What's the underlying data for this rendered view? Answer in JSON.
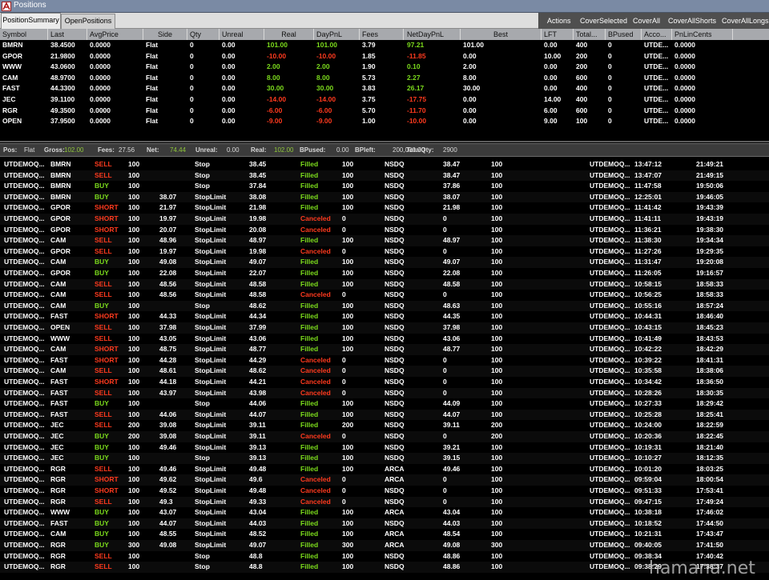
{
  "window": {
    "title": "Positions",
    "icon": "app-logo-icon"
  },
  "tabs": [
    {
      "label": "PositionSummary",
      "active": true
    },
    {
      "label": "OpenPositions",
      "active": false
    }
  ],
  "actions": [
    "Actions",
    "CoverSelected",
    "CoverAll",
    "CoverAllShorts",
    "CoverAllLongs"
  ],
  "colors": {
    "positive": "#7cdc1c",
    "negative": "#ff3a1e",
    "filled": "#7cdc1c",
    "canceled": "#ff3a1e",
    "buy": "#7cdc1c",
    "sell": "#ff3a1e",
    "header_bg": "#a7a9ad",
    "status_green": "#8fc63a"
  },
  "positions": {
    "columns": [
      "Symbol",
      "Last",
      "AvgPrice",
      "Side",
      "Qty",
      "Unreal",
      "Real",
      "DayPnL",
      "Fees",
      "NetDayPnL",
      "Best",
      "LFT",
      "Total...",
      "BPused",
      "Acco...",
      "PnLinCents"
    ],
    "rows": [
      {
        "cells": [
          "BMRN",
          "38.4500",
          "0.0000",
          "Flat",
          "0",
          "0.00",
          "101.00",
          "101.00",
          "3.79",
          "97.21",
          "101.00",
          "0.00",
          "400",
          "0",
          "UTDE...",
          "0.0000"
        ],
        "sign": "pos"
      },
      {
        "cells": [
          "GPOR",
          "21.9800",
          "0.0000",
          "Flat",
          "0",
          "0.00",
          "-10.00",
          "-10.00",
          "1.85",
          "-11.85",
          "0.00",
          "10.00",
          "200",
          "0",
          "UTDE...",
          "0.0000"
        ],
        "sign": "neg"
      },
      {
        "cells": [
          "WWW",
          "43.0600",
          "0.0000",
          "Flat",
          "0",
          "0.00",
          "2.00",
          "2.00",
          "1.90",
          "0.10",
          "2.00",
          "0.00",
          "200",
          "0",
          "UTDE...",
          "0.0000"
        ],
        "sign": "pos"
      },
      {
        "cells": [
          "CAM",
          "48.9700",
          "0.0000",
          "Flat",
          "0",
          "0.00",
          "8.00",
          "8.00",
          "5.73",
          "2.27",
          "8.00",
          "0.00",
          "600",
          "0",
          "UTDE...",
          "0.0000"
        ],
        "sign": "pos"
      },
      {
        "cells": [
          "FAST",
          "44.3300",
          "0.0000",
          "Flat",
          "0",
          "0.00",
          "30.00",
          "30.00",
          "3.83",
          "26.17",
          "30.00",
          "0.00",
          "400",
          "0",
          "UTDE...",
          "0.0000"
        ],
        "sign": "pos"
      },
      {
        "cells": [
          "JEC",
          "39.1100",
          "0.0000",
          "Flat",
          "0",
          "0.00",
          "-14.00",
          "-14.00",
          "3.75",
          "-17.75",
          "0.00",
          "14.00",
          "400",
          "0",
          "UTDE...",
          "0.0000"
        ],
        "sign": "neg"
      },
      {
        "cells": [
          "RGR",
          "49.3500",
          "0.0000",
          "Flat",
          "0",
          "0.00",
          "-6.00",
          "-6.00",
          "5.70",
          "-11.70",
          "0.00",
          "6.00",
          "600",
          "0",
          "UTDE...",
          "0.0000"
        ],
        "sign": "neg"
      },
      {
        "cells": [
          "OPEN",
          "37.9500",
          "0.0000",
          "Flat",
          "0",
          "0.00",
          "-9.00",
          "-9.00",
          "1.00",
          "-10.00",
          "0.00",
          "9.00",
          "100",
          "0",
          "UTDE...",
          "0.0000"
        ],
        "sign": "neg"
      }
    ]
  },
  "status": {
    "items": [
      {
        "label": "Pos:",
        "value": "Flat"
      },
      {
        "label": "Gross:",
        "value": "102.00",
        "green": true
      },
      {
        "label": "Fees:",
        "value": "27.56"
      },
      {
        "label": "Net:",
        "value": "74.44",
        "green": true
      },
      {
        "label": "Unreal:",
        "value": "0.00"
      },
      {
        "label": "Real:",
        "value": "102.00",
        "green": true
      },
      {
        "label": "BPused:",
        "value": "0.00"
      },
      {
        "label": "BPleft:",
        "value": "200,000.00"
      },
      {
        "label": "TotalQty:",
        "value": "2900"
      }
    ]
  },
  "orders": {
    "rows": [
      [
        "UTDEMOQ...",
        "BMRN",
        "SELL",
        "100",
        "",
        "Stop",
        "38.45",
        "Filled",
        "100",
        "NSDQ",
        "38.47",
        "100",
        "",
        "UTDEMOQ...",
        "13:47:12",
        "21:49:21"
      ],
      [
        "UTDEMOQ...",
        "BMRN",
        "SELL",
        "100",
        "",
        "Stop",
        "38.45",
        "Filled",
        "100",
        "NSDQ",
        "38.47",
        "100",
        "",
        "UTDEMOQ...",
        "13:47:07",
        "21:49:15"
      ],
      [
        "UTDEMOQ...",
        "BMRN",
        "BUY",
        "100",
        "",
        "Stop",
        "37.84",
        "Filled",
        "100",
        "NSDQ",
        "37.86",
        "100",
        "",
        "UTDEMOQ...",
        "11:47:58",
        "19:50:06"
      ],
      [
        "UTDEMOQ...",
        "BMRN",
        "BUY",
        "100",
        "38.07",
        "StopLimit",
        "38.08",
        "Filled",
        "100",
        "NSDQ",
        "38.07",
        "100",
        "",
        "UTDEMOQ...",
        "12:25:01",
        "19:46:05"
      ],
      [
        "UTDEMOQ...",
        "GPOR",
        "SHORT",
        "100",
        "21.97",
        "StopLimit",
        "21.98",
        "Filled",
        "100",
        "NSDQ",
        "21.98",
        "100",
        "",
        "UTDEMOQ...",
        "11:41:42",
        "19:43:39"
      ],
      [
        "UTDEMOQ...",
        "GPOR",
        "SHORT",
        "100",
        "19.97",
        "StopLimit",
        "19.98",
        "Canceled",
        "0",
        "NSDQ",
        "0",
        "100",
        "",
        "UTDEMOQ...",
        "11:41:11",
        "19:43:19"
      ],
      [
        "UTDEMOQ...",
        "GPOR",
        "SHORT",
        "100",
        "20.07",
        "StopLimit",
        "20.08",
        "Canceled",
        "0",
        "NSDQ",
        "0",
        "100",
        "",
        "UTDEMOQ...",
        "11:36:21",
        "19:38:30"
      ],
      [
        "UTDEMOQ...",
        "CAM",
        "SELL",
        "100",
        "48.96",
        "StopLimit",
        "48.97",
        "Filled",
        "100",
        "NSDQ",
        "48.97",
        "100",
        "",
        "UTDEMOQ...",
        "11:38:30",
        "19:34:34"
      ],
      [
        "UTDEMOQ...",
        "GPOR",
        "SELL",
        "100",
        "19.97",
        "StopLimit",
        "19.98",
        "Canceled",
        "0",
        "NSDQ",
        "0",
        "100",
        "",
        "UTDEMOQ...",
        "11:27:26",
        "19:29:35"
      ],
      [
        "UTDEMOQ...",
        "CAM",
        "BUY",
        "100",
        "49.08",
        "StopLimit",
        "49.07",
        "Filled",
        "100",
        "NSDQ",
        "49.07",
        "100",
        "",
        "UTDEMOQ...",
        "11:31:47",
        "19:20:08"
      ],
      [
        "UTDEMOQ...",
        "GPOR",
        "BUY",
        "100",
        "22.08",
        "StopLimit",
        "22.07",
        "Filled",
        "100",
        "NSDQ",
        "22.08",
        "100",
        "",
        "UTDEMOQ...",
        "11:26:05",
        "19:16:57"
      ],
      [
        "UTDEMOQ...",
        "CAM",
        "SELL",
        "100",
        "48.56",
        "StopLimit",
        "48.58",
        "Filled",
        "100",
        "NSDQ",
        "48.58",
        "100",
        "",
        "UTDEMOQ...",
        "10:58:15",
        "18:58:33"
      ],
      [
        "UTDEMOQ...",
        "CAM",
        "SELL",
        "100",
        "48.56",
        "StopLimit",
        "48.58",
        "Canceled",
        "0",
        "NSDQ",
        "0",
        "100",
        "",
        "UTDEMOQ...",
        "10:56:25",
        "18:58:33"
      ],
      [
        "UTDEMOQ...",
        "CAM",
        "BUY",
        "100",
        "",
        "Stop",
        "48.62",
        "Filled",
        "100",
        "NSDQ",
        "48.63",
        "100",
        "",
        "UTDEMOQ...",
        "10:55:16",
        "18:57:24"
      ],
      [
        "UTDEMOQ...",
        "FAST",
        "SHORT",
        "100",
        "44.33",
        "StopLimit",
        "44.34",
        "Filled",
        "100",
        "NSDQ",
        "44.35",
        "100",
        "",
        "UTDEMOQ...",
        "10:44:31",
        "18:46:40"
      ],
      [
        "UTDEMOQ...",
        "OPEN",
        "SELL",
        "100",
        "37.98",
        "StopLimit",
        "37.99",
        "Filled",
        "100",
        "NSDQ",
        "37.98",
        "100",
        "",
        "UTDEMOQ...",
        "10:43:15",
        "18:45:23"
      ],
      [
        "UTDEMOQ...",
        "WWW",
        "SELL",
        "100",
        "43.05",
        "StopLimit",
        "43.06",
        "Filled",
        "100",
        "NSDQ",
        "43.06",
        "100",
        "",
        "UTDEMOQ...",
        "10:41:49",
        "18:43:53"
      ],
      [
        "UTDEMOQ...",
        "CAM",
        "SHORT",
        "100",
        "48.75",
        "StopLimit",
        "48.77",
        "Filled",
        "100",
        "NSDQ",
        "48.77",
        "100",
        "",
        "UTDEMOQ...",
        "10:42:22",
        "18:42:29"
      ],
      [
        "UTDEMOQ...",
        "FAST",
        "SHORT",
        "100",
        "44.28",
        "StopLimit",
        "44.29",
        "Canceled",
        "0",
        "NSDQ",
        "0",
        "100",
        "",
        "UTDEMOQ...",
        "10:39:22",
        "18:41:31"
      ],
      [
        "UTDEMOQ...",
        "CAM",
        "SELL",
        "100",
        "48.61",
        "StopLimit",
        "48.62",
        "Canceled",
        "0",
        "NSDQ",
        "0",
        "100",
        "",
        "UTDEMOQ...",
        "10:35:58",
        "18:38:06"
      ],
      [
        "UTDEMOQ...",
        "FAST",
        "SHORT",
        "100",
        "44.18",
        "StopLimit",
        "44.21",
        "Canceled",
        "0",
        "NSDQ",
        "0",
        "100",
        "",
        "UTDEMOQ...",
        "10:34:42",
        "18:36:50"
      ],
      [
        "UTDEMOQ...",
        "FAST",
        "SELL",
        "100",
        "43.97",
        "StopLimit",
        "43.98",
        "Canceled",
        "0",
        "NSDQ",
        "0",
        "100",
        "",
        "UTDEMOQ...",
        "10:28:26",
        "18:30:35"
      ],
      [
        "UTDEMOQ...",
        "FAST",
        "BUY",
        "100",
        "",
        "Stop",
        "44.06",
        "Filled",
        "100",
        "NSDQ",
        "44.09",
        "100",
        "",
        "UTDEMOQ...",
        "10:27:33",
        "18:29:42"
      ],
      [
        "UTDEMOQ...",
        "FAST",
        "SELL",
        "100",
        "44.06",
        "StopLimit",
        "44.07",
        "Filled",
        "100",
        "NSDQ",
        "44.07",
        "100",
        "",
        "UTDEMOQ...",
        "10:25:28",
        "18:25:41"
      ],
      [
        "UTDEMOQ...",
        "JEC",
        "SELL",
        "200",
        "39.08",
        "StopLimit",
        "39.11",
        "Filled",
        "200",
        "NSDQ",
        "39.11",
        "200",
        "",
        "UTDEMOQ...",
        "10:24:00",
        "18:22:59"
      ],
      [
        "UTDEMOQ...",
        "JEC",
        "BUY",
        "200",
        "39.08",
        "StopLimit",
        "39.11",
        "Canceled",
        "0",
        "NSDQ",
        "0",
        "200",
        "",
        "UTDEMOQ...",
        "10:20:36",
        "18:22:45"
      ],
      [
        "UTDEMOQ...",
        "JEC",
        "BUY",
        "100",
        "49.46",
        "StopLimit",
        "39.13",
        "Filled",
        "100",
        "NSDQ",
        "39.21",
        "100",
        "",
        "UTDEMOQ...",
        "10:19:31",
        "18:21:40"
      ],
      [
        "UTDEMOQ...",
        "JEC",
        "BUY",
        "100",
        "",
        "Stop",
        "39.13",
        "Filled",
        "100",
        "NSDQ",
        "39.15",
        "100",
        "",
        "UTDEMOQ...",
        "10:10:27",
        "18:12:35"
      ],
      [
        "UTDEMOQ...",
        "RGR",
        "SELL",
        "100",
        "49.46",
        "StopLimit",
        "49.48",
        "Filled",
        "100",
        "ARCA",
        "49.46",
        "100",
        "",
        "UTDEMOQ...",
        "10:01:20",
        "18:03:25"
      ],
      [
        "UTDEMOQ...",
        "RGR",
        "SHORT",
        "100",
        "49.62",
        "StopLimit",
        "49.6",
        "Canceled",
        "0",
        "ARCA",
        "0",
        "100",
        "",
        "UTDEMOQ...",
        "09:59:04",
        "18:00:54"
      ],
      [
        "UTDEMOQ...",
        "RGR",
        "SHORT",
        "100",
        "49.52",
        "StopLimit",
        "49.48",
        "Canceled",
        "0",
        "NSDQ",
        "0",
        "100",
        "",
        "UTDEMOQ...",
        "09:51:33",
        "17:53:41"
      ],
      [
        "UTDEMOQ...",
        "RGR",
        "SELL",
        "100",
        "49.3",
        "StopLimit",
        "49.33",
        "Canceled",
        "0",
        "NSDQ",
        "0",
        "100",
        "",
        "UTDEMOQ...",
        "09:47:15",
        "17:49:24"
      ],
      [
        "UTDEMOQ...",
        "WWW",
        "BUY",
        "100",
        "43.07",
        "StopLimit",
        "43.04",
        "Filled",
        "100",
        "ARCA",
        "43.04",
        "100",
        "",
        "UTDEMOQ...",
        "10:38:18",
        "17:46:02"
      ],
      [
        "UTDEMOQ...",
        "FAST",
        "BUY",
        "100",
        "44.07",
        "StopLimit",
        "44.03",
        "Filled",
        "100",
        "NSDQ",
        "44.03",
        "100",
        "",
        "UTDEMOQ...",
        "10:18:52",
        "17:44:50"
      ],
      [
        "UTDEMOQ...",
        "CAM",
        "BUY",
        "100",
        "48.55",
        "StopLimit",
        "48.52",
        "Filled",
        "100",
        "ARCA",
        "48.54",
        "100",
        "",
        "UTDEMOQ...",
        "10:21:31",
        "17:43:47"
      ],
      [
        "UTDEMOQ...",
        "RGR",
        "BUY",
        "300",
        "49.08",
        "StopLimit",
        "49.07",
        "Filled",
        "300",
        "ARCA",
        "49.08",
        "300",
        "",
        "UTDEMOQ...",
        "09:40:05",
        "17:41:50"
      ],
      [
        "UTDEMOQ...",
        "RGR",
        "SELL",
        "100",
        "",
        "Stop",
        "48.8",
        "Filled",
        "100",
        "NSDQ",
        "48.86",
        "100",
        "",
        "UTDEMOQ...",
        "09:38:34",
        "17:40:42"
      ],
      [
        "UTDEMOQ...",
        "RGR",
        "SELL",
        "100",
        "",
        "Stop",
        "48.8",
        "Filled",
        "100",
        "NSDQ",
        "48.86",
        "100",
        "",
        "UTDEMOQ...",
        "09:38:29",
        "17:38:37"
      ]
    ]
  },
  "watermark": "hamana.net"
}
